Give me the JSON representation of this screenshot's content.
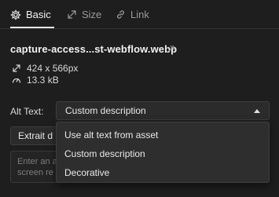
{
  "tabs": [
    {
      "label": "Basic",
      "icon": "gear-icon",
      "active": true
    },
    {
      "label": "Size",
      "icon": "resize-arrows-icon",
      "active": false
    },
    {
      "label": "Link",
      "icon": "link-icon",
      "active": false
    }
  ],
  "asset": {
    "filename": "capture-access...st-webflow.webp",
    "dimensions": "424 x 566px",
    "filesize": "13.3 kB"
  },
  "alt_text": {
    "label": "Alt Text:",
    "selected": "Custom description",
    "options": [
      "Use alt text from asset",
      "Custom description",
      "Decorative"
    ],
    "input_value": "Extrait d",
    "textarea_placeholder": "Enter an a screen re"
  },
  "colors": {
    "background": "#1e1e1e",
    "field": "#2b2b2b",
    "menu": "#2e2e2e",
    "text": "#e6e6e6",
    "muted": "#9a9a9a"
  }
}
